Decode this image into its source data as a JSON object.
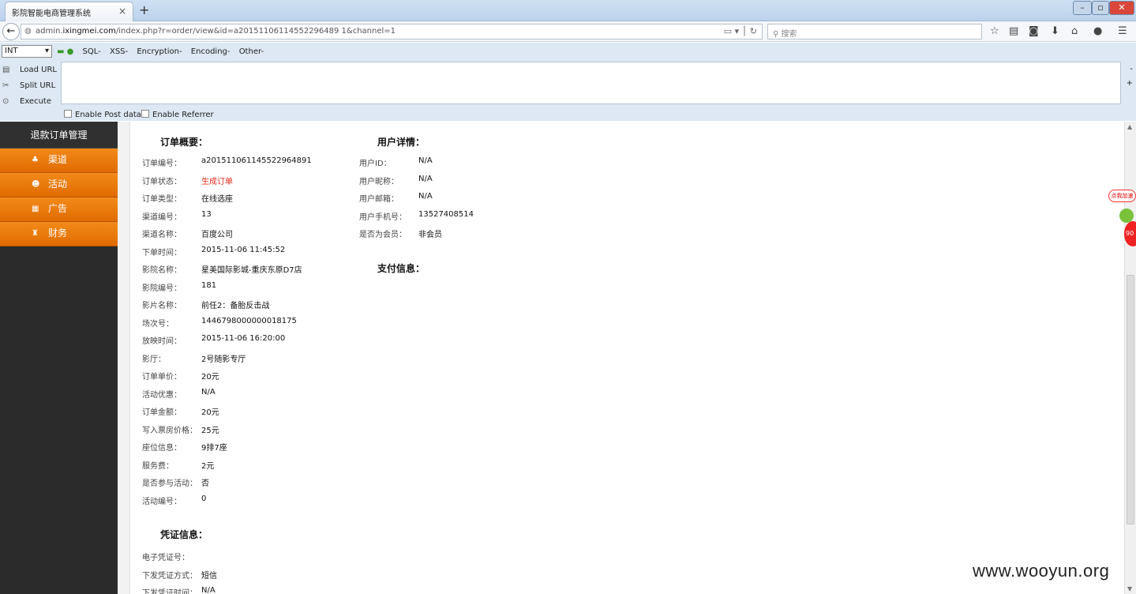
{
  "browser": {
    "tab_title": "影院智能电商管理系统",
    "tab_close": "×",
    "new_tab": "+",
    "url_prefix": "admin.",
    "url_domain": "ixingmei.com",
    "url_path": "/index.php?r=order/view&id=a20151106114552296489 1&channel=1",
    "search_placeholder": "搜索"
  },
  "hackbar": {
    "select_value": "INT",
    "menus": [
      "SQL-",
      "XSS-",
      "Encryption-",
      "Encoding-",
      "Other-"
    ],
    "buttons": [
      "Load URL",
      "Split URL",
      "Execute"
    ],
    "checks": [
      "Enable Post data",
      "Enable Referrer"
    ]
  },
  "sidebar": {
    "header": "退款订单管理",
    "items": [
      {
        "label": "渠道",
        "icon": "channel-icon"
      },
      {
        "label": "活动",
        "icon": "activity-icon"
      },
      {
        "label": "广告",
        "icon": "ad-icon"
      },
      {
        "label": "财务",
        "icon": "finance-icon"
      }
    ]
  },
  "order_summary": {
    "title": "订单概要：",
    "rows": [
      {
        "k": "订单编号：",
        "v": "a201511061145522964891"
      },
      {
        "k": "订单状态：",
        "v": "生成订单"
      },
      {
        "k": "订单类型：",
        "v": "在线选座"
      },
      {
        "k": "渠道编号：",
        "v": "13"
      },
      {
        "k": "渠道名称：",
        "v": "百度公司"
      },
      {
        "k": "下单时间：",
        "v": "2015-11-06 11:45:52"
      },
      {
        "k": "影院名称：",
        "v": "星美国际影城-重庆东原D7店"
      },
      {
        "k": "影院编号：",
        "v": "181"
      },
      {
        "k": "影片名称：",
        "v": "前任2：备胎反击战"
      },
      {
        "k": "场次号：",
        "v": "1446798000000018175"
      },
      {
        "k": "放映时间：",
        "v": "2015-11-06 16:20:00"
      },
      {
        "k": "影厅：",
        "v": "2号随影专厅"
      },
      {
        "k": "订单单价：",
        "v": "20元"
      },
      {
        "k": "活动优惠：",
        "v": "N/A"
      },
      {
        "k": "订单金额：",
        "v": "20元"
      },
      {
        "k": "写入票房价格：",
        "v": "25元"
      },
      {
        "k": "座位信息：",
        "v": "9排7座"
      },
      {
        "k": "服务费：",
        "v": "2元"
      },
      {
        "k": "是否参与活动：",
        "v": "否"
      },
      {
        "k": "活动编号：",
        "v": "0"
      }
    ]
  },
  "user_details": {
    "title": "用户详情：",
    "rows": [
      {
        "k": "用户ID：",
        "v": "N/A"
      },
      {
        "k": "用户昵称：",
        "v": "N/A"
      },
      {
        "k": "用户邮箱：",
        "v": "N/A"
      },
      {
        "k": "用户手机号：",
        "v": "13527408514"
      },
      {
        "k": "是否为会员：",
        "v": "非会员"
      }
    ]
  },
  "payment": {
    "title": "支付信息："
  },
  "voucher": {
    "title": "凭证信息：",
    "rows": [
      {
        "k": "电子凭证号：",
        "v": ""
      },
      {
        "k": "下发凭证方式：",
        "v": "短信"
      },
      {
        "k": "下发凭证时间：",
        "v": "N/A"
      }
    ]
  },
  "float_widget": {
    "badge": "点我加速",
    "ball": "90"
  },
  "watermark": "www.wooyun.org",
  "colors": {
    "accent": "#e87800",
    "status_red": "#e02b1a"
  }
}
